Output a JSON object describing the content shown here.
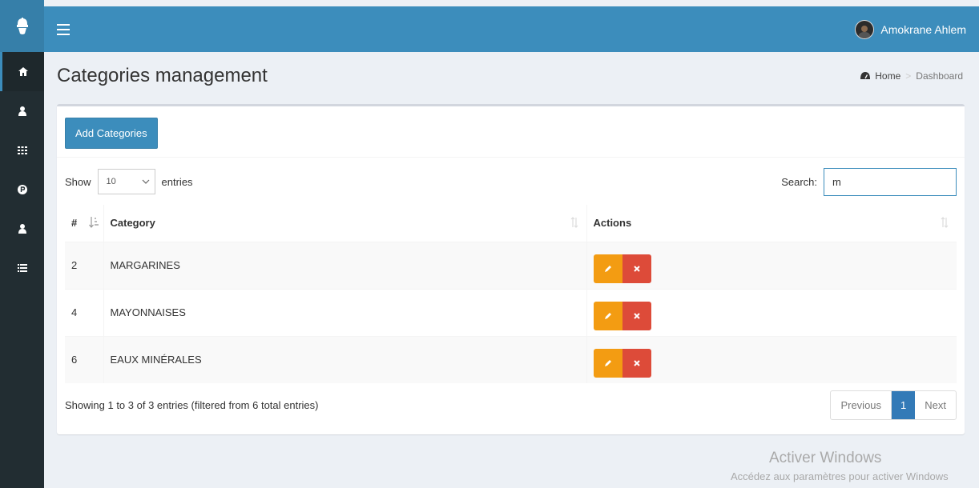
{
  "colors": {
    "primary": "#3c8dbc",
    "sidebar": "#222d32",
    "edit": "#f39c12",
    "delete": "#dd4b39",
    "page_active": "#337ab7"
  },
  "sidebar": {
    "logo_icon": "helmet-logo-icon",
    "items": [
      {
        "icon": "home-icon",
        "active": true
      },
      {
        "icon": "user-icon",
        "active": false
      },
      {
        "icon": "grid-icon",
        "active": false
      },
      {
        "icon": "parking-icon",
        "active": false
      },
      {
        "icon": "user-icon",
        "active": false
      },
      {
        "icon": "list-icon",
        "active": false
      }
    ]
  },
  "topbar": {
    "menu_icon": "hamburger-icon",
    "user_name": "Amokrane Ahlem"
  },
  "header": {
    "title": "Categories management",
    "breadcrumb": {
      "home": "Home",
      "current": "Dashboard"
    }
  },
  "box": {
    "add_button": "Add Categories",
    "length": {
      "show": "Show",
      "value": "10",
      "entries": "entries"
    },
    "search": {
      "label": "Search:",
      "value": "m"
    },
    "table": {
      "columns": [
        "#",
        "Category",
        "Actions"
      ],
      "rows": [
        {
          "num": "2",
          "category": "MARGARINES"
        },
        {
          "num": "4",
          "category": "MAYONNAISES"
        },
        {
          "num": "6",
          "category": "EAUX MINÉRALES"
        }
      ]
    },
    "info": "Showing 1 to 3 of 3 entries (filtered from 6 total entries)",
    "pagination": {
      "previous": "Previous",
      "current": "1",
      "next": "Next"
    }
  },
  "watermark": {
    "line1": "Activer Windows",
    "line2": "Accédez aux paramètres pour activer Windows"
  }
}
